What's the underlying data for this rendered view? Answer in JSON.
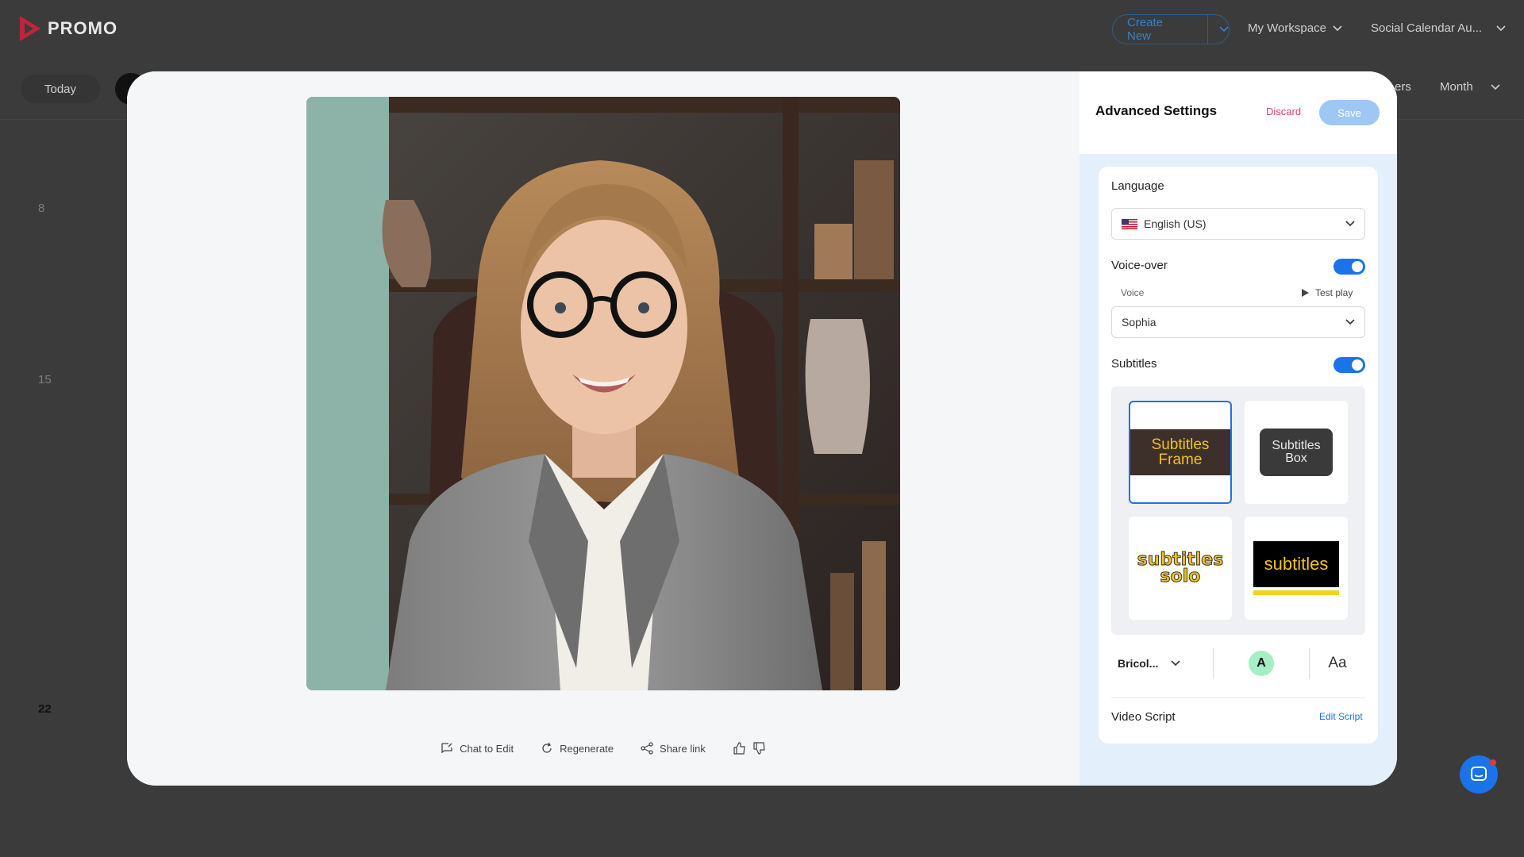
{
  "app": {
    "logo_text": "PROMO"
  },
  "header": {
    "create_new": "Create New",
    "workspace": "My Workspace",
    "calendar": "Social Calendar Au..."
  },
  "toolbar": {
    "today": "Today",
    "filters_fragment": "ers",
    "view": "Month"
  },
  "calendar_dates": [
    "8",
    "15",
    "22"
  ],
  "video_actions": {
    "chat_to_edit": "Chat to Edit",
    "regenerate": "Regenerate",
    "share_link": "Share link"
  },
  "settings": {
    "title": "Advanced Settings",
    "discard": "Discard",
    "save": "Save",
    "language_label": "Language",
    "language_value": "English (US)",
    "voiceover_label": "Voice-over",
    "voiceover_on": true,
    "voice_label": "Voice",
    "test_play": "Test play",
    "voice_value": "Sophia",
    "subtitles_label": "Subtitles",
    "subtitles_on": true,
    "subtitle_styles": [
      {
        "line1": "Subtitles",
        "line2": "Frame"
      },
      {
        "line1": "Subtitles",
        "line2": "Box"
      },
      {
        "line1": "subtitles",
        "line2": "solo"
      },
      {
        "line1": "subtitles",
        "line2": ""
      }
    ],
    "font_value": "Bricol...",
    "color_letter": "A",
    "text_case_icon": "Aa",
    "video_script_label": "Video Script",
    "edit_script": "Edit Script"
  },
  "colors": {
    "accent": "#1a73e8",
    "discard": "#e0426b",
    "subtitle_yellow": "#f2c31b",
    "color_swatch": "#a5efc5"
  }
}
